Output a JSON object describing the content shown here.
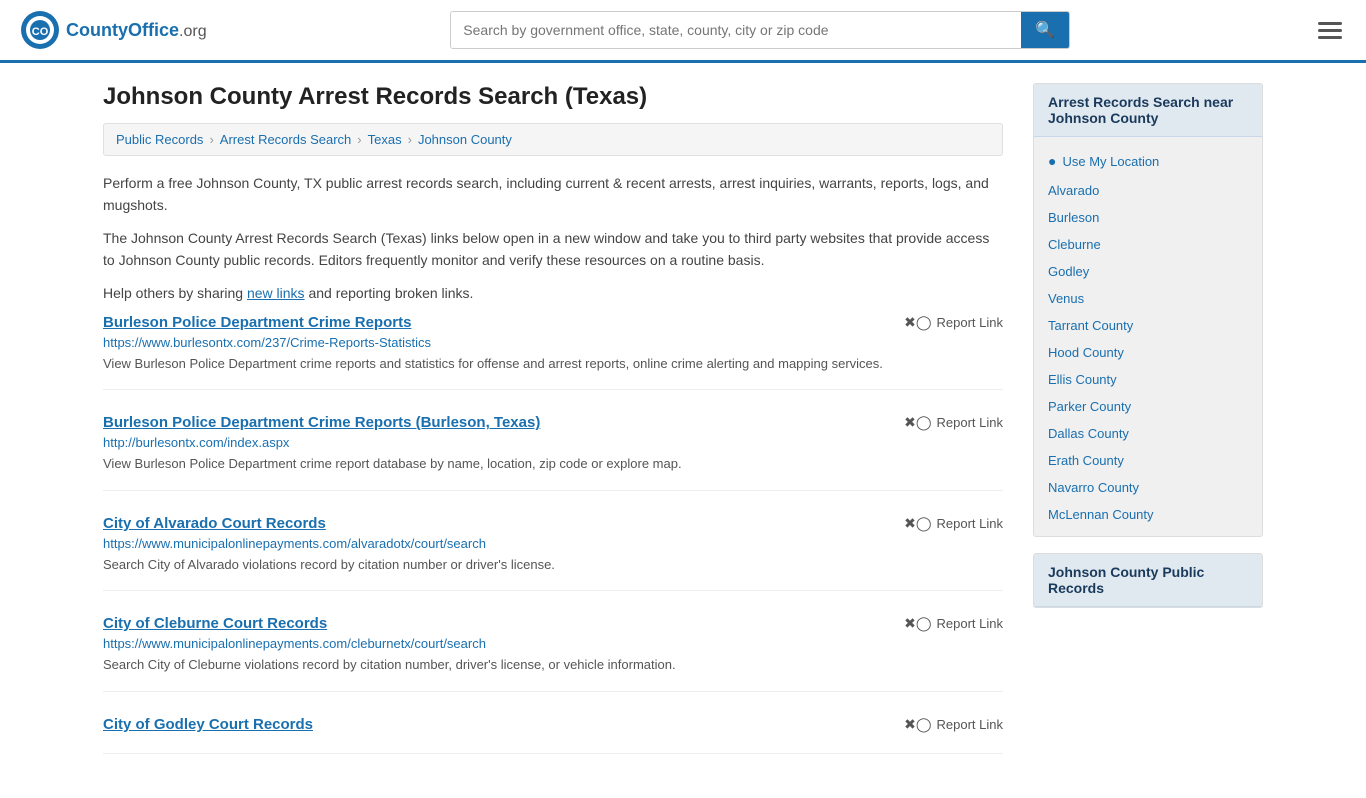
{
  "header": {
    "logo_text": "CountyOffice",
    "logo_suffix": ".org",
    "search_placeholder": "Search by government office, state, county, city or zip code",
    "search_value": ""
  },
  "page": {
    "title": "Johnson County Arrest Records Search (Texas)"
  },
  "breadcrumb": {
    "items": [
      {
        "label": "Public Records",
        "href": "#"
      },
      {
        "label": "Arrest Records Search",
        "href": "#"
      },
      {
        "label": "Texas",
        "href": "#"
      },
      {
        "label": "Johnson County",
        "href": "#"
      }
    ]
  },
  "description": [
    "Perform a free Johnson County, TX public arrest records search, including current & recent arrests, arrest inquiries, warrants, reports, logs, and mugshots.",
    "The Johnson County Arrest Records Search (Texas) links below open in a new window and take you to third party websites that provide access to Johnson County public records. Editors frequently monitor and verify these resources on a routine basis.",
    "Help others by sharing new links and reporting broken links."
  ],
  "results": [
    {
      "title": "Burleson Police Department Crime Reports",
      "url": "https://www.burlesontx.com/237/Crime-Reports-Statistics",
      "description": "View Burleson Police Department crime reports and statistics for offense and arrest reports, online crime alerting and mapping services.",
      "report_label": "Report Link"
    },
    {
      "title": "Burleson Police Department Crime Reports (Burleson, Texas)",
      "url": "http://burlesontx.com/index.aspx",
      "description": "View Burleson Police Department crime report database by name, location, zip code or explore map.",
      "report_label": "Report Link"
    },
    {
      "title": "City of Alvarado Court Records",
      "url": "https://www.municipalonlinepayments.com/alvaradotx/court/search",
      "description": "Search City of Alvarado violations record by citation number or driver's license.",
      "report_label": "Report Link"
    },
    {
      "title": "City of Cleburne Court Records",
      "url": "https://www.municipalonlinepayments.com/cleburnetx/court/search",
      "description": "Search City of Cleburne violations record by citation number, driver's license, or vehicle information.",
      "report_label": "Report Link"
    },
    {
      "title": "City of Godley Court Records",
      "url": "",
      "description": "",
      "report_label": "Report Link"
    }
  ],
  "sidebar": {
    "nearby_section_title": "Arrest Records Search near Johnson County",
    "use_my_location": "Use My Location",
    "nearby_links": [
      "Alvarado",
      "Burleson",
      "Cleburne",
      "Godley",
      "Venus",
      "Tarrant County",
      "Hood County",
      "Ellis County",
      "Parker County",
      "Dallas County",
      "Erath County",
      "Navarro County",
      "McLennan County"
    ],
    "public_records_title": "Johnson County Public Records"
  }
}
